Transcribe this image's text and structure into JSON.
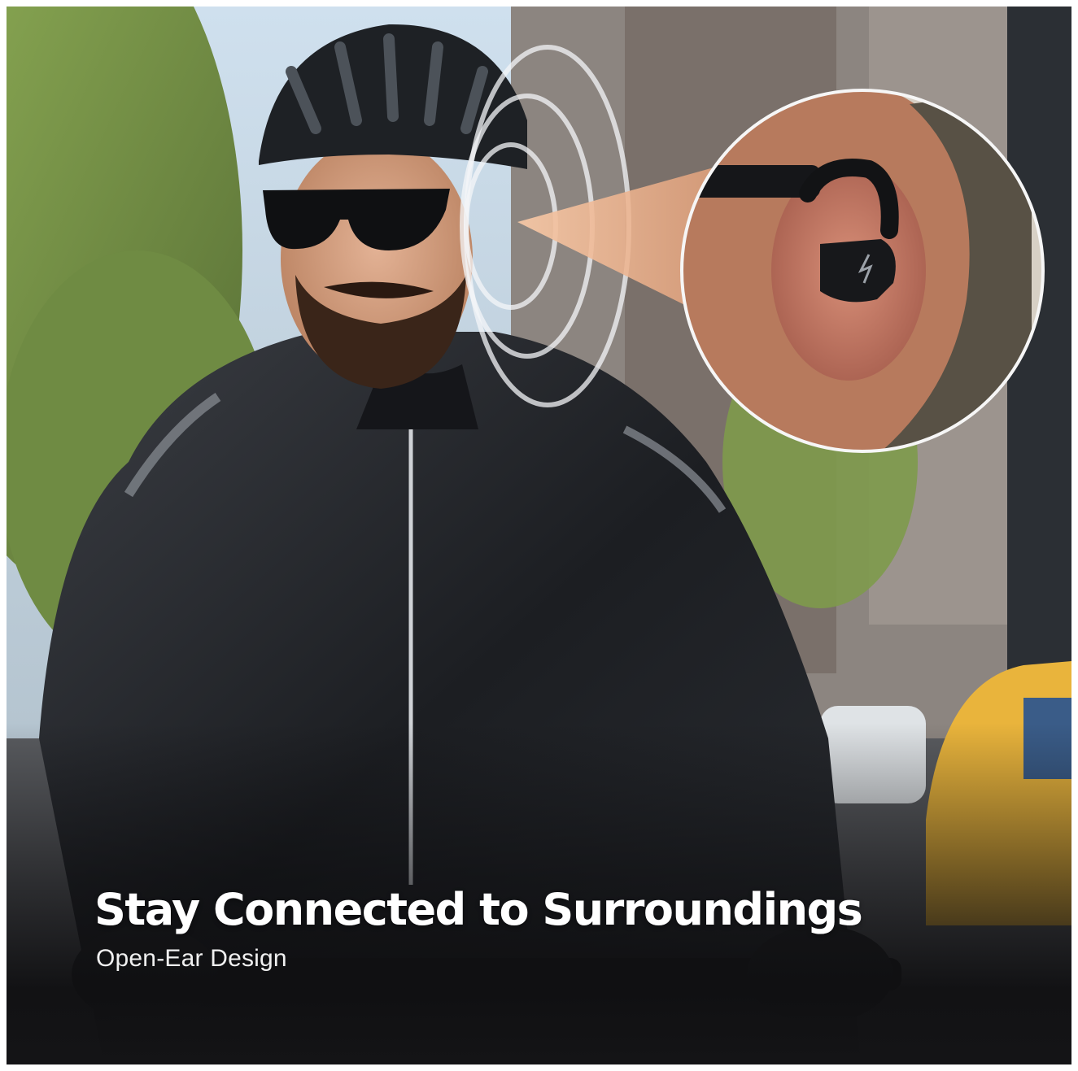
{
  "hero": {
    "title": "Stay Connected to Surroundings",
    "subtitle": "Open-Ear Design"
  },
  "colors": {
    "accent_callout": "#f0b48f",
    "caption_text": "#ffffff",
    "bottom_fade": "#141416"
  },
  "icons": [
    "sound-wave-icon",
    "magnifier-callout"
  ]
}
